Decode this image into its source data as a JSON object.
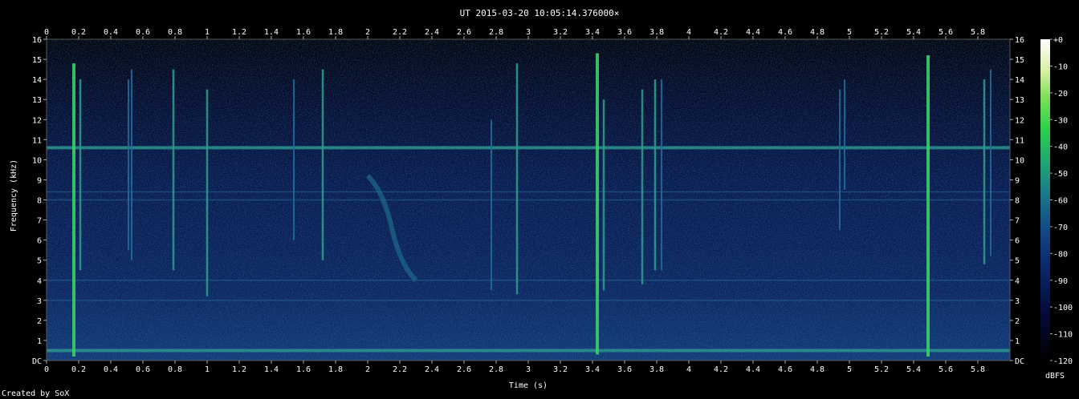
{
  "chart_data": {
    "type": "heatmap",
    "title": "UT 2015-03-20 10:05:14.376000×",
    "xlabel": "Time (s)",
    "ylabel": "Frequency (kHz)",
    "xlim": [
      0,
      6.0
    ],
    "ylim": [
      0,
      16
    ],
    "x_ticks": [
      "0",
      "0.2",
      "0.4",
      "0.6",
      "0.8",
      "1",
      "1.2",
      "1.4",
      "1.6",
      "1.8",
      "2",
      "2.2",
      "2.4",
      "2.6",
      "2.8",
      "3",
      "3.2",
      "3.4",
      "3.6",
      "3.8",
      "4",
      "4.2",
      "4.4",
      "4.6",
      "4.8",
      "5",
      "5.2",
      "5.4",
      "5.6",
      "5.8"
    ],
    "x_tick_values": [
      0,
      0.2,
      0.4,
      0.6,
      0.8,
      1,
      1.2,
      1.4,
      1.6,
      1.8,
      2,
      2.2,
      2.4,
      2.6,
      2.8,
      3,
      3.2,
      3.4,
      3.6,
      3.8,
      4,
      4.2,
      4.4,
      4.6,
      4.8,
      5,
      5.2,
      5.4,
      5.6,
      5.8
    ],
    "y_ticks": [
      "DC",
      "1",
      "2",
      "3",
      "4",
      "5",
      "6",
      "7",
      "8",
      "9",
      "10",
      "11",
      "12",
      "13",
      "14",
      "15",
      "16"
    ],
    "colorbar": {
      "label": "dBFS",
      "ticks": [
        "+0",
        "-10",
        "-20",
        "-30",
        "-40",
        "-50",
        "-60",
        "-70",
        "-80",
        "-90",
        "-100",
        "-110",
        "-120"
      ],
      "range": [
        -120,
        0
      ]
    },
    "features": {
      "horizontal_bands_khz": [
        10.6,
        8.4,
        8.0,
        4.0,
        3.0,
        0.5
      ],
      "vertical_transients": [
        {
          "t": 0.17,
          "f_low": 0.2,
          "f_high": 14.8,
          "level": "high"
        },
        {
          "t": 0.21,
          "f_low": 4.5,
          "f_high": 14.0,
          "level": "mid"
        },
        {
          "t": 0.51,
          "f_low": 5.5,
          "f_high": 14.0,
          "level": "low"
        },
        {
          "t": 0.53,
          "f_low": 5.0,
          "f_high": 14.5,
          "level": "low"
        },
        {
          "t": 0.79,
          "f_low": 4.5,
          "f_high": 14.5,
          "level": "mid"
        },
        {
          "t": 1.0,
          "f_low": 3.2,
          "f_high": 13.5,
          "level": "mid"
        },
        {
          "t": 1.54,
          "f_low": 6.0,
          "f_high": 14.0,
          "level": "low"
        },
        {
          "t": 1.72,
          "f_low": 5.0,
          "f_high": 14.5,
          "level": "mid"
        },
        {
          "t": 2.77,
          "f_low": 3.5,
          "f_high": 12.0,
          "level": "low"
        },
        {
          "t": 2.93,
          "f_low": 3.3,
          "f_high": 14.8,
          "level": "mid"
        },
        {
          "t": 3.43,
          "f_low": 0.3,
          "f_high": 15.3,
          "level": "high"
        },
        {
          "t": 3.47,
          "f_low": 3.5,
          "f_high": 13.0,
          "level": "mid"
        },
        {
          "t": 3.71,
          "f_low": 3.8,
          "f_high": 13.5,
          "level": "mid"
        },
        {
          "t": 3.79,
          "f_low": 4.5,
          "f_high": 14.0,
          "level": "mid"
        },
        {
          "t": 3.83,
          "f_low": 4.5,
          "f_high": 14.0,
          "level": "low"
        },
        {
          "t": 4.94,
          "f_low": 6.5,
          "f_high": 13.5,
          "level": "low"
        },
        {
          "t": 4.97,
          "f_low": 8.5,
          "f_high": 14.0,
          "level": "low"
        },
        {
          "t": 5.49,
          "f_low": 0.2,
          "f_high": 15.2,
          "level": "high"
        },
        {
          "t": 5.84,
          "f_low": 4.8,
          "f_high": 14.0,
          "level": "mid"
        },
        {
          "t": 5.88,
          "f_low": 5.2,
          "f_high": 14.5,
          "level": "low"
        }
      ],
      "chirp": {
        "t_start": 2.0,
        "f_start": 9.2,
        "t_end": 2.3,
        "f_end": 4.0
      }
    },
    "grid": false,
    "legend": "colorbar-right"
  },
  "footer": "Created by SoX",
  "colors": {
    "background": "#000000",
    "low": "#000818",
    "mid": "#1c4f8f",
    "high": "#38c878",
    "peak": "#ffffff"
  }
}
